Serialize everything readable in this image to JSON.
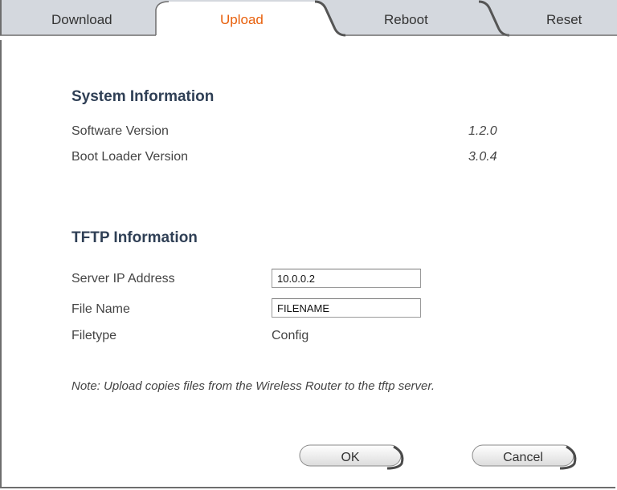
{
  "tabs": [
    {
      "label": "Download",
      "active": false
    },
    {
      "label": "Upload",
      "active": true
    },
    {
      "label": "Reboot",
      "active": false
    },
    {
      "label": "Reset",
      "active": false
    }
  ],
  "system": {
    "title": "System Information",
    "rows": [
      {
        "label": "Software Version",
        "value": "1.2.0"
      },
      {
        "label": "Boot Loader Version",
        "value": "3.0.4"
      }
    ]
  },
  "tftp": {
    "title": "TFTP Information",
    "server_ip_label": "Server IP Address",
    "server_ip_value": "10.0.0.2",
    "file_name_label": "File Name",
    "file_name_value": "FILENAME",
    "filetype_label": "Filetype",
    "filetype_value": "Config"
  },
  "note": "Note: Upload copies files from the Wireless Router to the tftp server.",
  "buttons": {
    "ok": "OK",
    "cancel": "Cancel"
  },
  "colors": {
    "active_tab": "#e8600c",
    "tab_bg": "#cfd3d9",
    "heading": "#2f3f55"
  }
}
